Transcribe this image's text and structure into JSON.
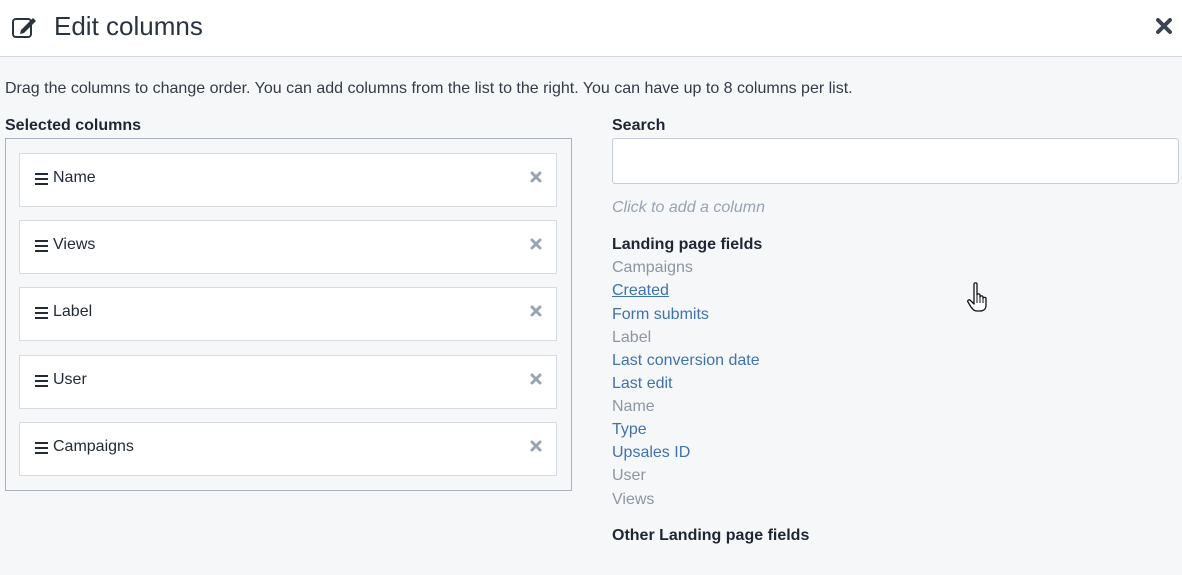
{
  "modal": {
    "title": "Edit columns",
    "icons": {
      "header": "edit-icon",
      "close": "close-icon",
      "remove": "remove-icon",
      "drag": "drag-handle-icon"
    }
  },
  "description": "Drag the columns to change order. You can add columns from the list to the right. You can have up to 8 columns per list.",
  "selected": {
    "label": "Selected columns",
    "columns": [
      "Name",
      "Views",
      "Label",
      "User",
      "Campaigns"
    ]
  },
  "search": {
    "label": "Search",
    "value": "",
    "placeholder": ""
  },
  "hint": "Click to add a column",
  "groups": [
    {
      "title": "Landing page fields",
      "fields": [
        {
          "label": "Campaigns",
          "state": "used"
        },
        {
          "label": "Created",
          "state": "active-hover"
        },
        {
          "label": "Form submits",
          "state": "active"
        },
        {
          "label": "Label",
          "state": "used"
        },
        {
          "label": "Last conversion date",
          "state": "active"
        },
        {
          "label": "Last edit",
          "state": "active"
        },
        {
          "label": "Name",
          "state": "used"
        },
        {
          "label": "Type",
          "state": "active"
        },
        {
          "label": "Upsales ID",
          "state": "active"
        },
        {
          "label": "User",
          "state": "used"
        },
        {
          "label": "Views",
          "state": "used"
        }
      ]
    },
    {
      "title": "Other Landing page fields",
      "fields": []
    }
  ],
  "colors": {
    "link": "#3f72af",
    "muted": "#8c96a3",
    "hint": "#97a3b3",
    "background": "#f6f7f9"
  }
}
